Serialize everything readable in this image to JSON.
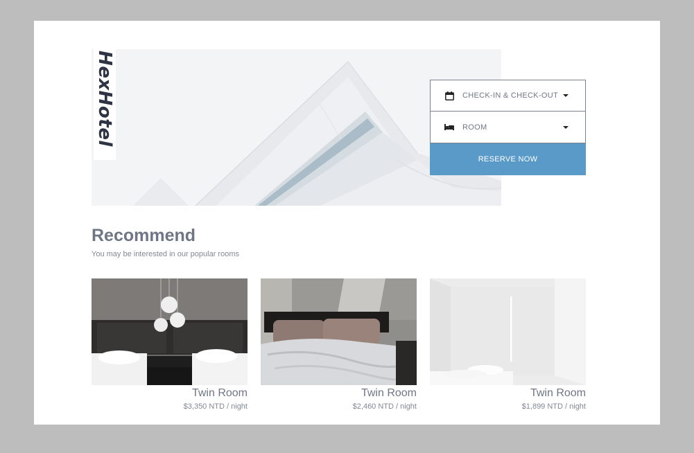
{
  "brand": {
    "name": "HexHotel"
  },
  "booking": {
    "dates_label": "CHECK-IN & CHECK-OUT",
    "room_label": "ROOM",
    "reserve_label": "RESERVE NOW",
    "calendar_icon": "calendar-icon",
    "bed_icon": "bed-icon"
  },
  "recommend": {
    "title": "Recommend",
    "subtitle": "You may be interested in our popular rooms",
    "rooms": [
      {
        "name": "Twin Room",
        "price": "$3,350 NTD / night"
      },
      {
        "name": "Twin Room",
        "price": "$2,460 NTD / night"
      },
      {
        "name": "Twin Room",
        "price": "$1,899 NTD / night"
      }
    ]
  },
  "colors": {
    "accent": "#5a9ac8",
    "heading": "#6e7686",
    "brand_text": "#2f3444",
    "page_bg": "#bdbdbd"
  }
}
